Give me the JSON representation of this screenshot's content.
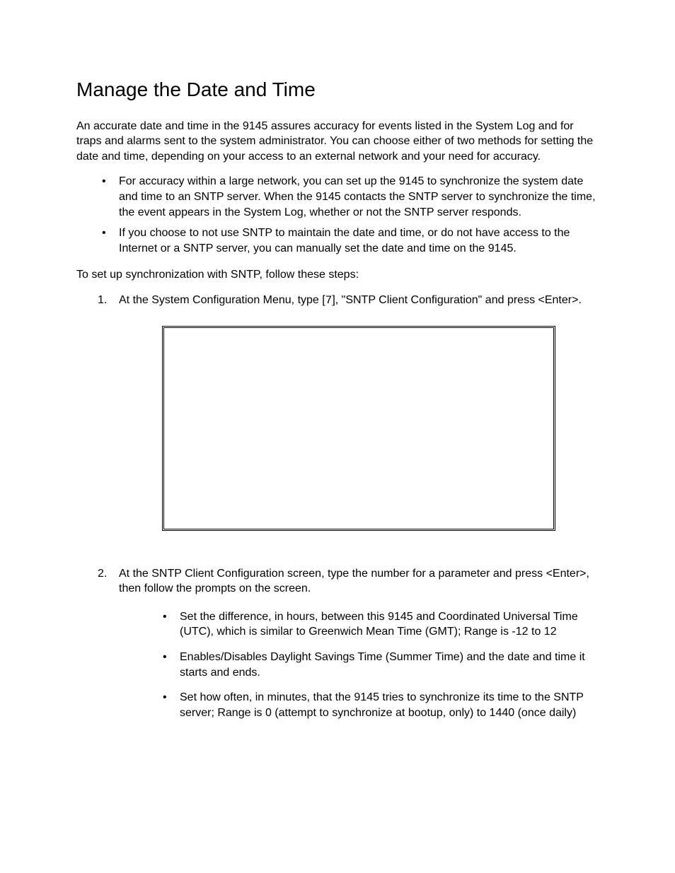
{
  "title": "Manage the Date and Time",
  "intro": "An accurate date and time in the 9145 assures accuracy for events listed in the System Log and for traps and alarms sent to the system administrator.  You can choose either of two methods for setting the date and time, depending on your access to an external network and your need for accuracy.",
  "bullets": [
    "For accuracy within a large network, you can set up the 9145 to synchronize the system date and time to an SNTP server.  When the 9145 contacts the SNTP server to synchronize the time, the event appears in the System Log, whether or not the SNTP server responds.",
    "If you choose to not use SNTP to maintain the date and time, or do not have access to the Internet or a SNTP server, you can manually set the date and time on the 9145."
  ],
  "lead": "To set up synchronization with SNTP, follow these steps:",
  "step1": {
    "pre": "At the System Configuration Menu, type [",
    "key": "7",
    "post": "], \"SNTP Client Configuration\" and press <Enter>."
  },
  "step2": {
    "text": "At the SNTP Client Configuration screen, type the number for a parameter and press <Enter>, then follow the prompts on the screen.",
    "items": [
      "Set the difference, in hours, between this 9145 and Coordinated Universal Time (UTC), which is similar to Greenwich Mean Time (GMT); Range is -12 to 12",
      "Enables/Disables Daylight Savings Time (Summer Time) and the date and time it starts and ends.",
      "Set how often, in minutes, that the 9145 tries to synchronize its time to the SNTP server; Range is 0 (attempt to synchronize at bootup, only) to 1440 (once daily)"
    ]
  }
}
